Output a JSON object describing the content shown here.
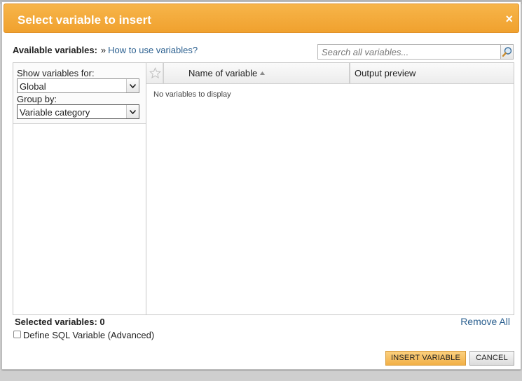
{
  "dialog": {
    "title": "Select variable to insert",
    "close_glyph": "×"
  },
  "available": {
    "label": "Available variables:",
    "separator": "»",
    "help_link": "How to use variables?"
  },
  "search": {
    "placeholder": "Search all variables...",
    "value": "",
    "icon": "magnifier-icon"
  },
  "filters": {
    "show_label": "Show variables for:",
    "show_value": "Global",
    "group_label": "Group by:",
    "group_value": "Variable category"
  },
  "grid": {
    "columns": [
      "Name of variable",
      "Output preview"
    ],
    "sort_column": "Name of variable",
    "sort_direction": "ascending",
    "empty_message": "No variables to display"
  },
  "footer": {
    "selected_label": "Selected variables: 0",
    "remove_all": "Remove All",
    "sql_checkbox_label": "Define SQL Variable (Advanced)",
    "sql_checked": false,
    "insert_button": "INSERT VARIABLE",
    "cancel_button": "CANCEL"
  },
  "colors": {
    "titlebar": "#f0a12e",
    "link": "#2a5f8f",
    "primary_button": "#f2b046"
  }
}
